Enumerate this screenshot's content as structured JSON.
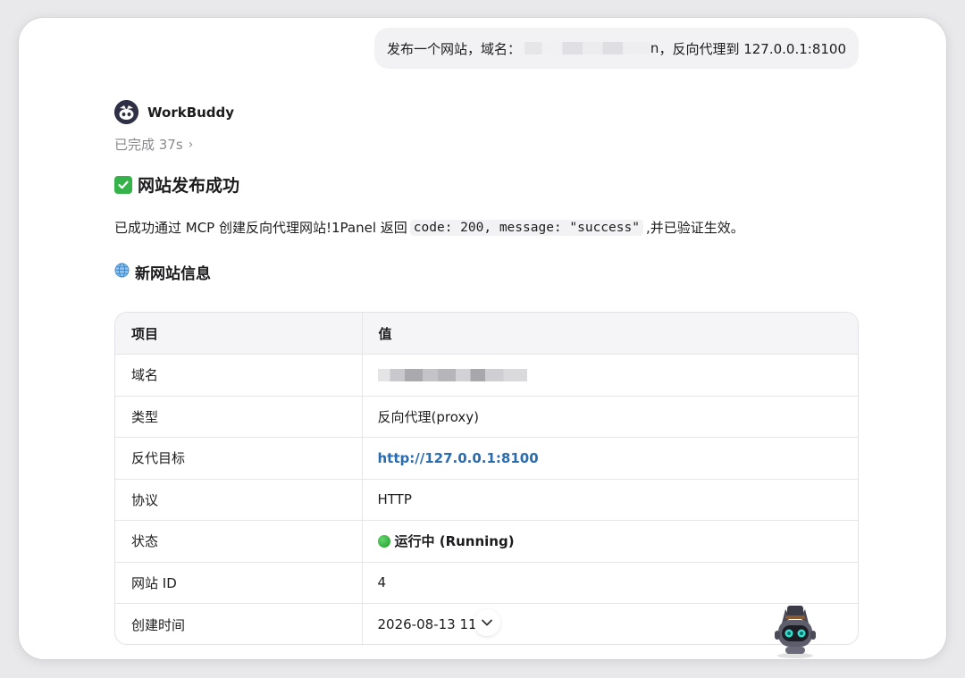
{
  "user_message": {
    "prefix": "发布一个网站，域名：",
    "suffix_tail": "n",
    "suffix": "，反向代理到 127.0.0.1:8100"
  },
  "assistant": {
    "name": "WorkBuddy",
    "status": "已完成 37s",
    "status_chevron": "›"
  },
  "content": {
    "success_heading": "网站发布成功",
    "para_before": "已成功通过 MCP 创建反向代理网站!1Panel 返回",
    "para_code": "code: 200, message: \"success\"",
    "para_after": ",并已验证生效。",
    "info_heading": "新网站信息"
  },
  "table": {
    "headers": [
      "项目",
      "值"
    ],
    "rows": [
      {
        "key": "域名",
        "value": ""
      },
      {
        "key": "类型",
        "value": "反向代理(proxy)"
      },
      {
        "key": "反代目标",
        "value": "http://127.0.0.1:8100"
      },
      {
        "key": "协议",
        "value": "HTTP"
      },
      {
        "key": "状态",
        "value": "运行中 (Running)"
      },
      {
        "key": "网站 ID",
        "value": "4"
      },
      {
        "key": "创建时间",
        "value": "2026-08-13 11"
      }
    ]
  },
  "colors": {
    "link": "#2a6cb0",
    "status_green": "#35b34a",
    "bubble": "#f2f2f4"
  },
  "icons": {
    "success": "check-box-icon",
    "info": "globe-icon",
    "running": "green-circle-icon",
    "scroll": "chevron-down-icon",
    "chevron": "chevron-right-icon"
  }
}
